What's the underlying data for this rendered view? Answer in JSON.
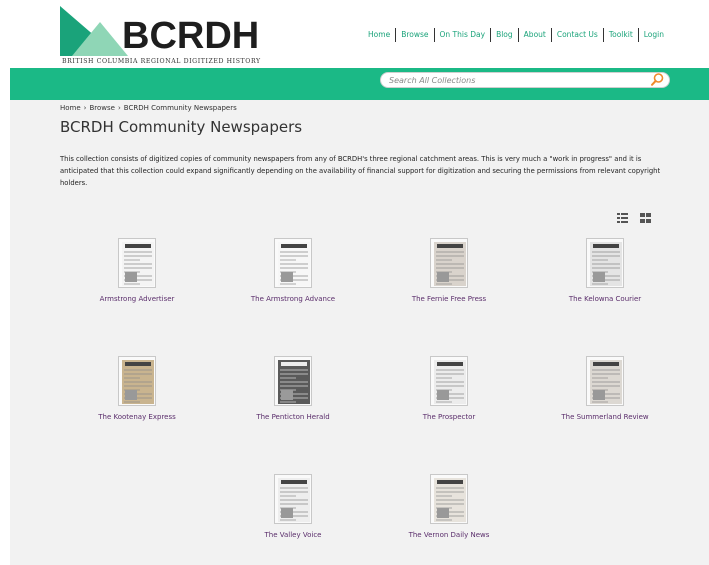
{
  "logo": {
    "wordmark": "BCRDH",
    "tagline": "BRITISH COLUMBIA REGIONAL DIGITIZED HISTORY"
  },
  "nav": {
    "items": [
      "Home",
      "Browse",
      "On This Day",
      "Blog",
      "About",
      "Contact Us",
      "Toolkit",
      "Login"
    ]
  },
  "search": {
    "placeholder": "Search All Collections"
  },
  "breadcrumb": [
    "Home",
    "Browse",
    "BCRDH Community Newspapers"
  ],
  "breadcrumb_sep": "›",
  "page": {
    "title": "BCRDH Community Newspapers",
    "description": "This collection consists of digitized copies of community newspapers from any of BCRDH's three regional catchment areas. This is very much a \"work in progress\" and it is anticipated that this collection could expand significantly depending on the availability of financial support for digitization and securing the permissions from relevant copyright holders."
  },
  "collections": [
    {
      "name": "Armstrong Advertiser",
      "tone": "#f4f4f4"
    },
    {
      "name": "The Armstrong Advance",
      "tone": "#f7f7f7"
    },
    {
      "name": "The Fernie Free Press",
      "tone": "#d9d3cc"
    },
    {
      "name": "The Kelowna Courier",
      "tone": "#e4e4e4"
    },
    {
      "name": "The Kootenay Express",
      "tone": "#c9b48f"
    },
    {
      "name": "The Penticton Herald",
      "tone": "#5a5a5a"
    },
    {
      "name": "The Prospector",
      "tone": "#ececec"
    },
    {
      "name": "The Summerland Review",
      "tone": "#dcd8d2"
    },
    {
      "name": "The Valley Voice",
      "tone": "#eeeeee"
    },
    {
      "name": "The Vernon Daily News",
      "tone": "#e7e3dc"
    }
  ],
  "colors": {
    "brand_green": "#1bb986",
    "logo_dark_green": "#1aa37a",
    "logo_light_green": "#8fd6b6",
    "link_purple": "#5a2d6b"
  }
}
